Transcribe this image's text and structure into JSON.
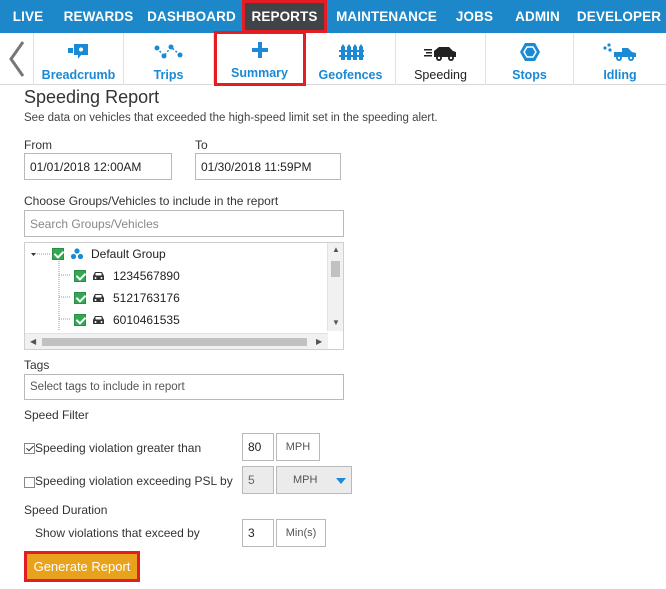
{
  "topnav": {
    "items": [
      {
        "label": "LIVE"
      },
      {
        "label": "REWARDS"
      },
      {
        "label": "DASHBOARD"
      },
      {
        "label": "REPORTS"
      },
      {
        "label": "MAINTENANCE"
      },
      {
        "label": "JOBS"
      },
      {
        "label": "ADMIN"
      },
      {
        "label": "DEVELOPER"
      }
    ],
    "active": "REPORTS"
  },
  "subnav": {
    "back_icon": "chevron-left-icon",
    "items": [
      {
        "label": "Breadcrumb",
        "icon": "breadcrumb-icon"
      },
      {
        "label": "Trips",
        "icon": "trips-icon"
      },
      {
        "label": "Summary",
        "icon": "plus-icon"
      },
      {
        "label": "Geofences",
        "icon": "geofence-icon"
      },
      {
        "label": "Speeding",
        "icon": "speeding-car-icon"
      },
      {
        "label": "Stops",
        "icon": "stop-hexagon-icon"
      },
      {
        "label": "Idling",
        "icon": "idling-truck-icon"
      }
    ],
    "current": "Speeding"
  },
  "page": {
    "title": "Speeding Report",
    "description": "See data on vehicles that exceeded the high-speed limit set in the speeding alert."
  },
  "form": {
    "from_label": "From",
    "from_value": "01/01/2018 12:00AM",
    "to_label": "To",
    "to_value": "01/30/2018 11:59PM",
    "groups_label": "Choose Groups/Vehicles to include in the report",
    "groups_placeholder": "Search Groups/Vehicles",
    "tree": {
      "group": "Default Group",
      "vehicles": [
        "1234567890",
        "5121763176",
        "6010461535"
      ]
    },
    "tags_label": "Tags",
    "tags_placeholder": "Select tags to include in report",
    "speed_filter_label": "Speed Filter",
    "filter1_label": "Speeding violation greater than",
    "filter1_value": "80",
    "filter1_unit": "MPH",
    "filter2_label": "Speeding violation exceeding PSL by",
    "filter2_value": "5",
    "filter2_unit": "MPH",
    "duration_label": "Speed Duration",
    "duration_text": "Show violations that exceed by",
    "duration_value": "3",
    "duration_unit": "Min(s)",
    "generate_label": "Generate Report"
  },
  "colors": {
    "nav_blue": "#1c87c9",
    "active_dark": "#404448",
    "highlight_red": "#e41c23",
    "link_blue": "#1a8ad4",
    "button_orange": "#e8a21b",
    "check_green": "#32a852"
  }
}
